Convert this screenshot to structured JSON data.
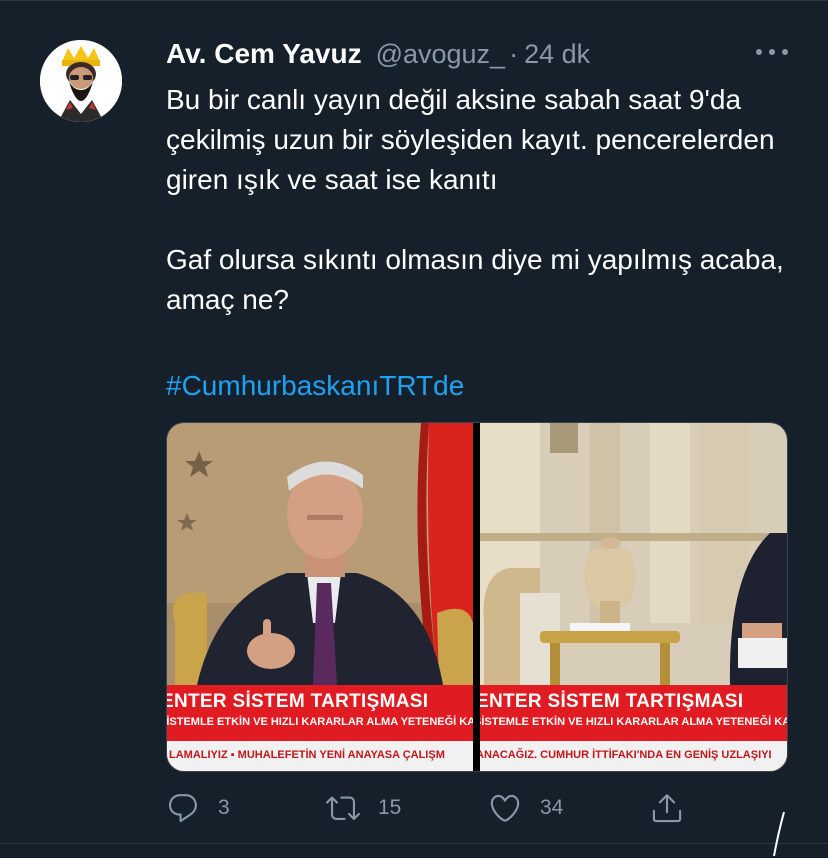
{
  "tweet": {
    "author_name": "Av. Cem Yavuz",
    "handle": "@avoguz_",
    "separator": "·",
    "time": "24 dk",
    "body": "Bu bir canlı yayın değil aksine sabah saat 9'da çekilmiş uzun bir söyleşiden kayıt. pencerelerden giren ışık ve saat ise kanıtı\n\nGaf olursa sıkıntı olmasın diye mi yapılmış acaba, amaç ne?",
    "hashtag": "#CumhurbaskanıTRTde"
  },
  "media": {
    "left": {
      "banner_title": "ENTER SİSTEM TARTIŞMASI",
      "banner_sub": "SİSTEMLE ETKİN VE HIZLI KARARLAR ALMA YETENEĞİ KAZA",
      "ticker": "LAMALIYIZ  ▪  MUHALEFETİN YENİ ANAYASA ÇALIŞM"
    },
    "right": {
      "banner_title": "ENTER SİSTEM TARTIŞMASI",
      "banner_sub": "SİSTEMLE ETKİN VE HIZLI KARARLAR ALMA YETENEĞİ KAZA",
      "ticker": "ANACAĞIZ. CUMHUR İTTİFAKI'NDA EN GENİŞ UZLAŞIYI"
    },
    "colors": {
      "banner": "#e01b22",
      "ticker_bg": "#f1f1f1",
      "ticker_text": "#c2161c"
    }
  },
  "actions": {
    "reply_count": "3",
    "retweet_count": "15",
    "like_count": "34"
  },
  "icons": {
    "reply": "reply-icon",
    "retweet": "retweet-icon",
    "like": "heart-icon",
    "share": "share-icon",
    "more": "more-options-icon"
  },
  "theme": {
    "background": "#15202b",
    "text": "#ffffff",
    "muted": "#8899a6",
    "link": "#1da1f2"
  }
}
